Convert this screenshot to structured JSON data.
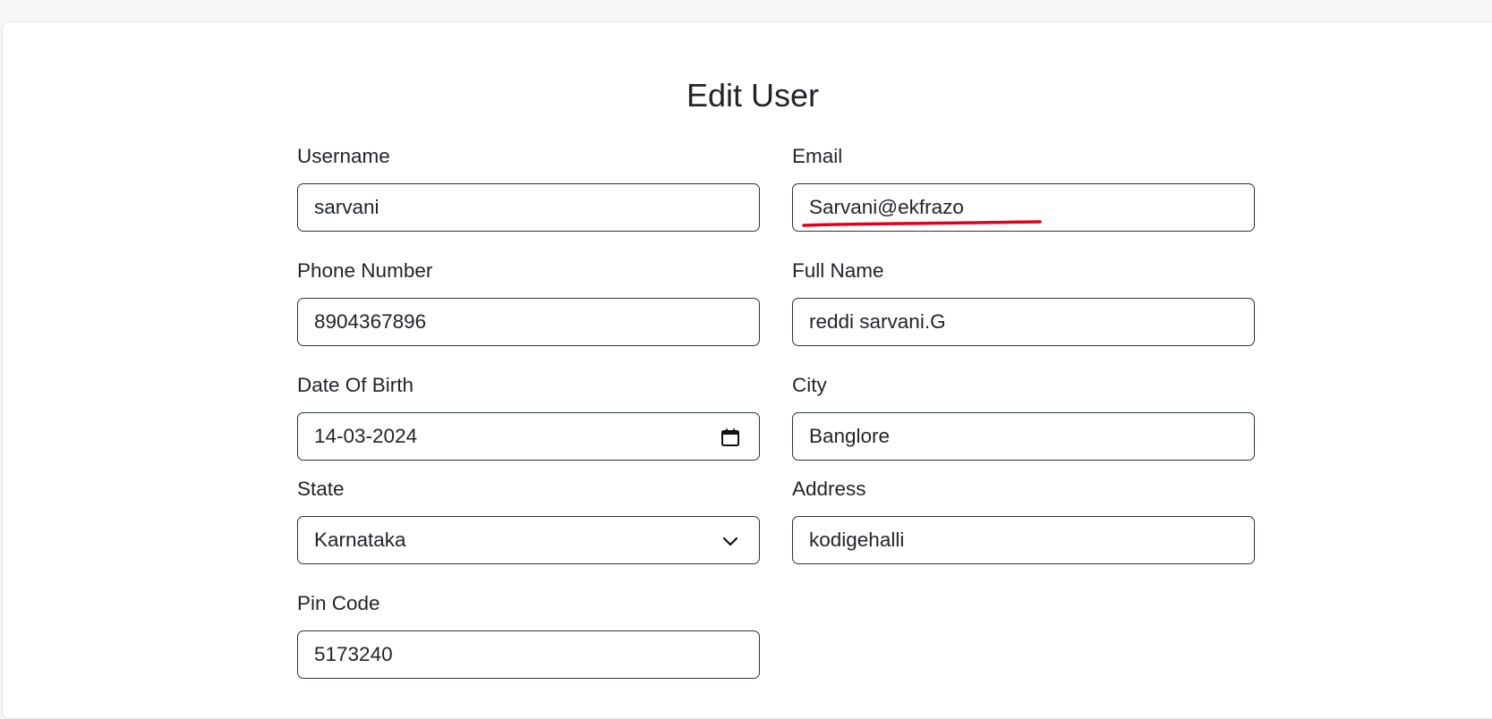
{
  "form": {
    "title": "Edit User",
    "fields": {
      "username": {
        "label": "Username",
        "value": "sarvani"
      },
      "email": {
        "label": "Email",
        "value": "Sarvani@ekfrazo"
      },
      "phone": {
        "label": "Phone Number",
        "value": "8904367896"
      },
      "full_name": {
        "label": "Full Name",
        "value": "reddi sarvani.G"
      },
      "dob": {
        "label": "Date Of Birth",
        "value": "14-03-2024"
      },
      "city": {
        "label": "City",
        "value": "Banglore"
      },
      "state": {
        "label": "State",
        "value": "Karnataka"
      },
      "address": {
        "label": "Address",
        "value": "kodigehalli"
      },
      "pin_code": {
        "label": "Pin Code",
        "value": "5173240"
      }
    }
  },
  "icons": {
    "dob": "calendar-icon",
    "state": "chevron-down-icon",
    "annotation": "red-underline-mark"
  },
  "colors": {
    "annotation": "#e3001b",
    "border": "#2b3440"
  }
}
